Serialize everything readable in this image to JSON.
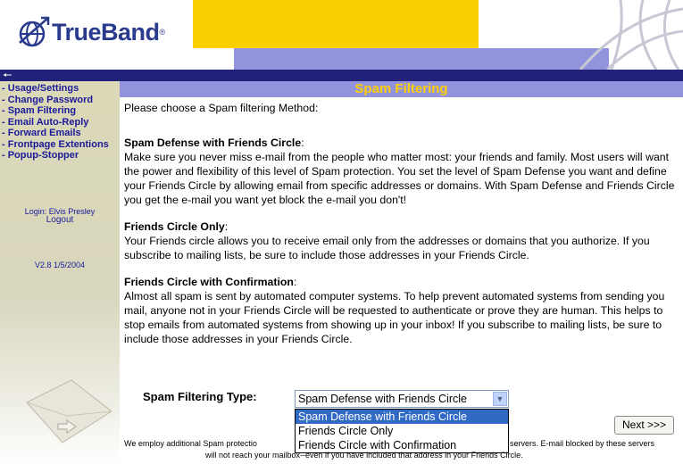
{
  "brand": {
    "name": "TrueBand",
    "registered": "®"
  },
  "sidebar": {
    "links": [
      {
        "label": "- Usage/Settings"
      },
      {
        "label": "- Change Password"
      },
      {
        "label": "- Spam Filtering"
      },
      {
        "label": "- Email Auto-Reply"
      },
      {
        "label": "- Forward Emails"
      },
      {
        "label": "- Frontpage Extentions"
      },
      {
        "label": "- Popup-Stopper"
      }
    ],
    "login": "Login: Elvis Presley",
    "logout": "Logout",
    "version": "V2.8 1/5/2004"
  },
  "main": {
    "title": "Spam Filtering",
    "intro": "Please choose a Spam filtering Method:",
    "sections": [
      {
        "title": "Spam Defense with Friends Circle",
        "colon": ":",
        "body": "Make sure you never miss e-mail from the people who matter most: your friends and family. Most users will want the power and flexibility of this level of Spam protection. You set the level of Spam Defense you want and define your Friends Circle by allowing email from specific addresses or domains. With Spam Defense and Friends Circle you get the e-mail you want yet block the e-mail you don't!"
      },
      {
        "title": "Friends Circle Only",
        "colon": ":",
        "body": "Your Friends circle allows you to receive email only from the addresses or domains that you authorize. If you subscribe to mailing lists, be sure to include those addresses in your Friends Circle."
      },
      {
        "title": "Friends Circle with Confirmation",
        "colon": ":",
        "body": "Almost all spam is sent by automated computer systems. To help prevent automated systems from sending you mail, anyone not in your Friends Circle will be requested to authenticate or prove they are human. This helps to stop emails from automated systems from showing up in your inbox! If you subscribe to mailing lists, be sure to include those addresses in your Friends Circle."
      }
    ],
    "filter_type_label": "Spam Filtering Type:",
    "selected_option": "Spam Defense with Friends Circle",
    "options": [
      "Spam Defense with Friends Circle",
      "Friends Circle Only",
      "Friends Circle with Confirmation"
    ],
    "next_button": "Next >>>",
    "footer_left": "We employ additional Spam protectio",
    "footer_right": "servers. E-mail blocked by these servers",
    "footer_line2": "will not reach your mailbox--even if you have included that address in your Friends Circle."
  },
  "colors": {
    "nav_blue": "#22227a",
    "title_bar": "#9393dd",
    "title_text": "#fcd000",
    "link": "#1a1a9a",
    "yellow": "#fcd000",
    "select_highlight": "#316ac5"
  }
}
